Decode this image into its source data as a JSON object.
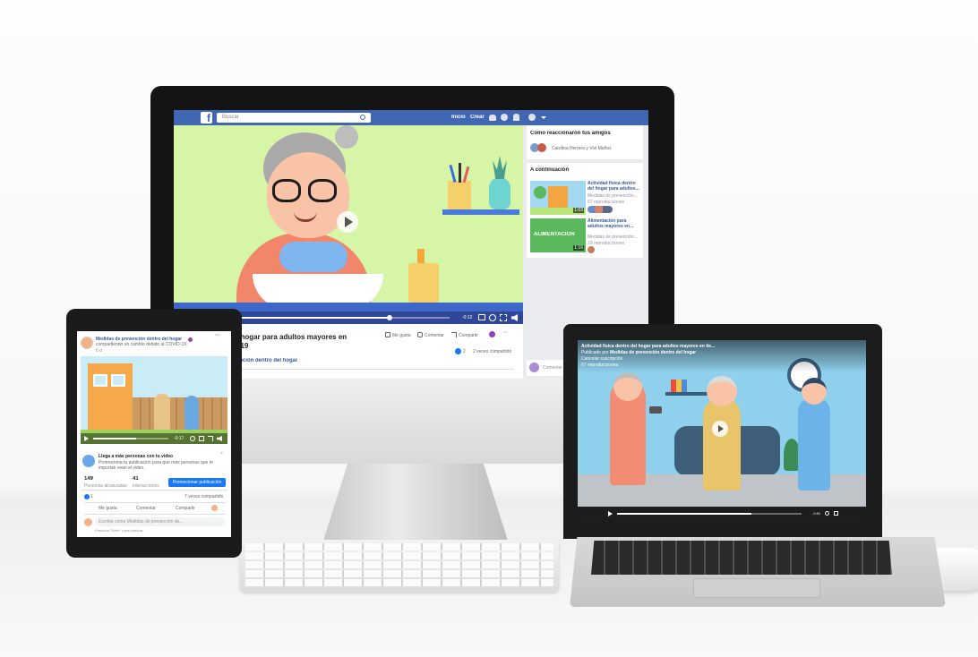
{
  "colors": {
    "fb_blue": "#4267b2",
    "video_green": "#d6f5a6",
    "link": "#385898",
    "promote": "#1877f2"
  },
  "imac": {
    "search_placeholder": "Buscar",
    "nav": {
      "home": "Inicio",
      "create": "Crear"
    },
    "video": {
      "time": "-0:12"
    },
    "post": {
      "title": "l hogar para adultos mayores en",
      "title2": "D-19",
      "page": "ención dentro del hogar",
      "like": "Me gusta",
      "comment": "Comentar",
      "share": "Compartir",
      "reactions": "2",
      "shares": "2 veces compartido"
    },
    "sidebar": {
      "reactions_title": "Cómo reaccionaron tus amigos",
      "friends": "Carolina Herrera y Vivi Muñoz",
      "next_title": "A continuación",
      "items": [
        {
          "title": "Actividad física dentro del hogar para adultos...",
          "page": "Medidas de prevención...",
          "views": "67 reproducciones",
          "duration": "1:03"
        },
        {
          "title": "Alimentación para adultos mayores en...",
          "page": "Medidas de prevención...",
          "views": "19 reproducciones",
          "duration": "1:16",
          "thumb_label": "ALIMENTACIÓN"
        }
      ],
      "comment_placeholder": "Comentar"
    }
  },
  "tablet": {
    "page": "Medidas de prevención dentro del hogar",
    "subtitle": "compartiendo un cambio debido al COVID-19.",
    "time": "5 d",
    "video_time": "-0:17",
    "promo_title": "Llega a más personas con tu video",
    "promo_text": "Promociona tu publicación para que más personas que te importan vean el video.",
    "reach_value": "149",
    "reach_label": "Personas alcanzadas",
    "interactions_value": "41",
    "interactions_label": "Interacciones",
    "promote_button": "Promocionar publicación",
    "reactions": "1",
    "shares": "7 veces compartido",
    "like": "Me gusta",
    "comment": "Comentar",
    "share": "Compartir",
    "comment_placeholder": "Escribe como Medidas de prevención de...",
    "enter_hint": "Presiona \"Enter\" para publicar."
  },
  "laptop": {
    "title": "Actividad física dentro del hogar para adultos mayores en tie...",
    "published": "Publicado por",
    "page": "Medidas de prevención dentro del hogar",
    "unsubscribe": "Cancelar suscripción",
    "views": "67 reproducciones",
    "time": "-0:51"
  }
}
